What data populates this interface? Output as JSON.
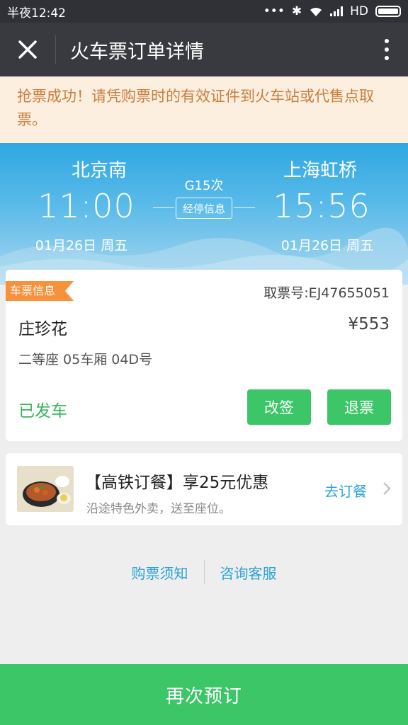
{
  "status_bar": {
    "time": "半夜12:42",
    "network": "HD"
  },
  "app_bar": {
    "close_icon": "close-icon",
    "title": "火车票订单详情",
    "more_icon": "more-vertical-icon"
  },
  "notice": {
    "text": "抢票成功！请凭购票时的有效证件到火车站或代售点取票。"
  },
  "trip": {
    "from_station": "北京南",
    "to_station": "上海虹桥",
    "depart_time": "11:00",
    "arrive_time": "15:56",
    "depart_date": "01月26日 周五",
    "arrive_date": "01月26日 周五",
    "train_no": "G15次",
    "stops_label": "经停信息"
  },
  "ticket": {
    "ribbon": "车票信息",
    "pickup_code": "取票号:EJ47655051",
    "passenger": "庄珍花",
    "price": "¥553",
    "seat": "二等座  05车厢 04D号",
    "status": "已发车",
    "change_label": "改签",
    "refund_label": "退票"
  },
  "meal": {
    "title": "【高铁订餐】享25元优惠",
    "subtitle": "沿途特色外卖，送至座位。",
    "action": "去订餐"
  },
  "links": {
    "notice_link": "购票须知",
    "service_link": "咨询客服"
  },
  "bottom": {
    "rebook_label": "再次预订"
  },
  "colors": {
    "accent_green": "#3dc668",
    "ribbon_orange": "#f7923c",
    "link_blue": "#2aa3d6",
    "notice_bg": "#fdefe0"
  }
}
